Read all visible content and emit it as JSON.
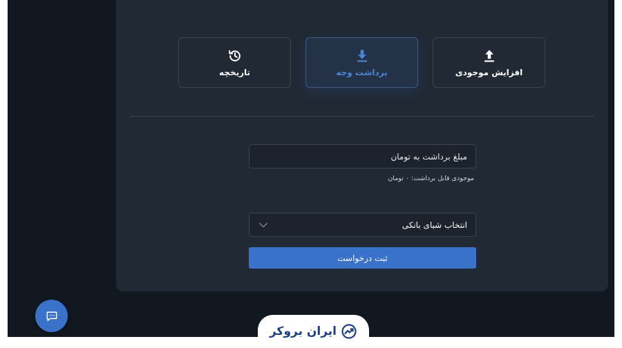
{
  "tabs": {
    "history_label": "تاریخچه",
    "withdraw_label": "برداشت وجه",
    "deposit_label": "افزایش موجودی",
    "active": "withdraw"
  },
  "form": {
    "amount_placeholder": "مبلغ برداشت به تومان",
    "withdrawable_hint": "موجودی قابل برداشت: ۰ تومان",
    "sheba_select_label": "انتخاب شبای بانکی",
    "submit_label": "ثبت درخواست"
  },
  "brand": {
    "name": "ایران بروکر"
  },
  "icons": {
    "history": "history-icon",
    "withdraw": "download-icon",
    "deposit": "upload-icon",
    "dropdown": "chevron-down-icon",
    "chat": "chat-icon",
    "logo": "trend-chart-icon"
  },
  "colors": {
    "accent": "#3a72c9",
    "active_tab_text": "#4a86d8",
    "card_bg": "#212934",
    "page_bg": "#111820",
    "brand_text": "#1f3f86"
  }
}
